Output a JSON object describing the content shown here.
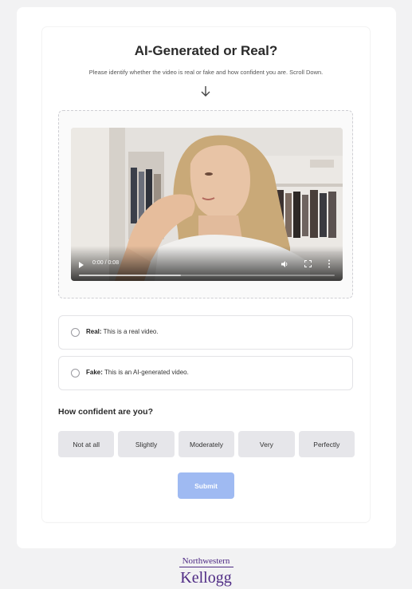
{
  "page": {
    "title": "AI-Generated or Real?",
    "instruction": "Please identify whether the video is real or fake and how confident you are. Scroll Down."
  },
  "video": {
    "time_display": "0:00 / 0:08",
    "progress_fraction": 0.0,
    "buffered_fraction": 0.4
  },
  "options": [
    {
      "label": "Real:",
      "description": "This is a real video."
    },
    {
      "label": "Fake:",
      "description": "This is an AI-generated video."
    }
  ],
  "confidence": {
    "question": "How confident are you?",
    "levels": [
      "Not at all",
      "Slightly",
      "Moderately",
      "Very",
      "Perfectly"
    ]
  },
  "submit": {
    "label": "Submit",
    "color": "#9fbaf2"
  },
  "footer": {
    "logo_top": "Northwestern",
    "logo_bottom": "Kellogg",
    "brand_color": "#4e2a84"
  }
}
